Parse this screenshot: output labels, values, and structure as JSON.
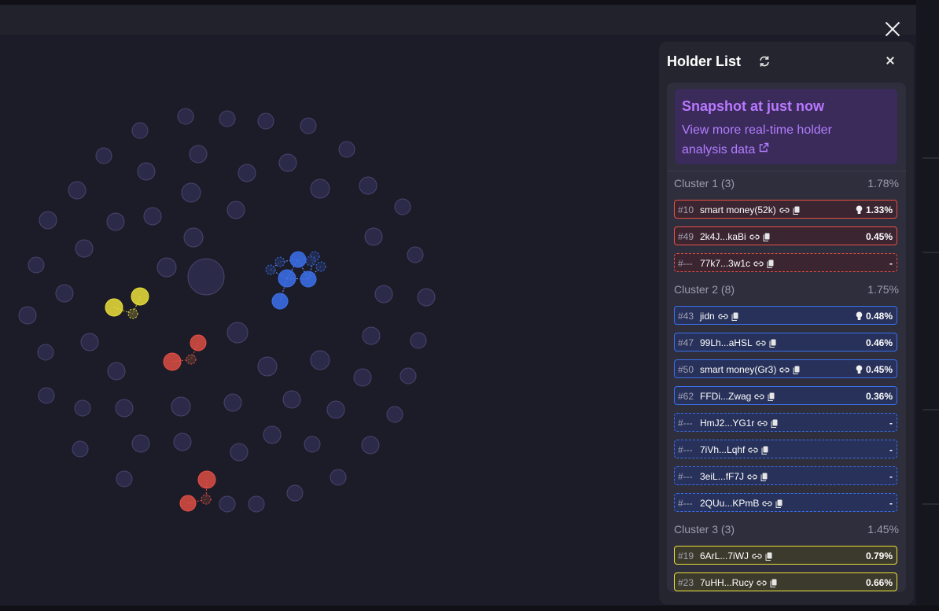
{
  "panel": {
    "title": "Holder List",
    "snapshot": {
      "title": "Snapshot at just now",
      "link": "View more real-time holder analysis data"
    },
    "clusters": [
      {
        "label": "Cluster 1 (3)",
        "percent": "1.78%",
        "color": "red",
        "rows": [
          {
            "rank": "#10",
            "name": "smart money(52k)",
            "percent": "1.33%",
            "bulb": true,
            "dashed": false
          },
          {
            "rank": "#49",
            "name": "2k4J...kaBi",
            "percent": "0.45%",
            "bulb": false,
            "dashed": false
          },
          {
            "rank": "#---",
            "name": "77k7...3w1c",
            "percent": "-",
            "bulb": false,
            "dashed": true
          }
        ]
      },
      {
        "label": "Cluster 2 (8)",
        "percent": "1.75%",
        "color": "blue",
        "rows": [
          {
            "rank": "#43",
            "name": "jidn",
            "percent": "0.48%",
            "bulb": true,
            "dashed": false
          },
          {
            "rank": "#47",
            "name": "99Lh...aHSL",
            "percent": "0.46%",
            "bulb": false,
            "dashed": false
          },
          {
            "rank": "#50",
            "name": "smart money(Gr3)",
            "percent": "0.45%",
            "bulb": true,
            "dashed": false
          },
          {
            "rank": "#62",
            "name": "FFDi...Zwag",
            "percent": "0.36%",
            "bulb": false,
            "dashed": false
          },
          {
            "rank": "#---",
            "name": "HmJ2...YG1r",
            "percent": "-",
            "bulb": false,
            "dashed": true
          },
          {
            "rank": "#---",
            "name": "7iVh...Lqhf",
            "percent": "-",
            "bulb": false,
            "dashed": true
          },
          {
            "rank": "#---",
            "name": "3eiL...fF7J",
            "percent": "-",
            "bulb": false,
            "dashed": true
          },
          {
            "rank": "#---",
            "name": "2QUu...KPmB",
            "percent": "-",
            "bulb": false,
            "dashed": true
          }
        ]
      },
      {
        "label": "Cluster 3 (3)",
        "percent": "1.45%",
        "color": "yellow",
        "rows": [
          {
            "rank": "#19",
            "name": "6ArL...7iWJ",
            "percent": "0.79%",
            "bulb": false,
            "dashed": false
          },
          {
            "rank": "#23",
            "name": "7uHH...Rucy",
            "percent": "0.66%",
            "bulb": false,
            "dashed": false
          }
        ]
      }
    ]
  },
  "colors": {
    "background": "#1c1c28",
    "node": "#2b2a48",
    "node_stroke": "#49446e",
    "cluster_red": "#e85045",
    "cluster_blue": "#3b70ea",
    "cluster_yellow": "#eadf3a",
    "accent_purple": "#b978ff"
  },
  "icons": {
    "refresh": "refresh-icon",
    "close": "close-icon",
    "link": "link-icon",
    "copy": "copy-icon",
    "external": "external-link-icon",
    "bulb": "lightbulb-icon"
  }
}
